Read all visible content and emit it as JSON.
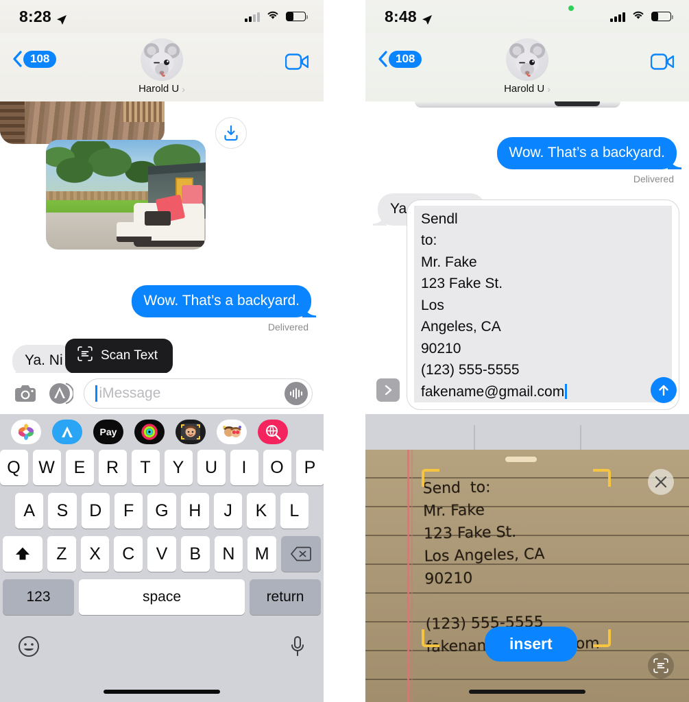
{
  "left_phone": {
    "status_bar": {
      "time": "8:28",
      "location_icon": "location-arrow-icon",
      "cellular": "signal-bars-icon",
      "wifi": "wifi-icon",
      "battery": "battery-icon"
    },
    "nav": {
      "back_badge": "108",
      "contact_name": "Harold U",
      "disclosure": "›",
      "video_label": "facetime-video-icon"
    },
    "messages": [
      {
        "type": "photo",
        "name": "deck-photo"
      },
      {
        "type": "photo",
        "name": "backyard-photo"
      },
      {
        "type": "outgoing",
        "text": "Wow. That’s a backyard.",
        "status": "Delivered"
      },
      {
        "type": "incoming",
        "text": "Ya.  Ni"
      }
    ],
    "download_button": "download-icon",
    "tooltip": {
      "label": "Scan Text",
      "icon": "scan-text-icon"
    },
    "input_bar": {
      "camera_icon": "camera-icon",
      "apps_icon": "app-store-icon",
      "placeholder": "iMessage",
      "audio_icon": "audio-waveform-icon"
    },
    "keyboard": {
      "app_strip": [
        {
          "name": "photos-app-icon",
          "glyph": "❀"
        },
        {
          "name": "app-store-icon",
          "glyph": "A"
        },
        {
          "name": "apple-pay-icon",
          "glyph": "Pay"
        },
        {
          "name": "fitness-rings-icon",
          "glyph": "◉"
        },
        {
          "name": "memoji-capture-icon",
          "glyph": "🙂"
        },
        {
          "name": "memoji-stickers-icon",
          "glyph": "😍"
        },
        {
          "name": "gif-search-icon",
          "glyph": "🔍"
        }
      ],
      "row1": [
        "Q",
        "W",
        "E",
        "R",
        "T",
        "Y",
        "U",
        "I",
        "O",
        "P"
      ],
      "row2": [
        "A",
        "S",
        "D",
        "F",
        "G",
        "H",
        "J",
        "K",
        "L"
      ],
      "row3": [
        "Z",
        "X",
        "C",
        "V",
        "B",
        "N",
        "M"
      ],
      "shift_icon": "shift-key-icon",
      "backspace_icon": "backspace-key-icon",
      "numbers_label": "123",
      "space_label": "space",
      "return_label": "return",
      "emoji_icon": "emoji-key-icon",
      "dictation_icon": "microphone-icon"
    }
  },
  "right_phone": {
    "status_bar": {
      "time": "8:48",
      "location_icon": "location-arrow-icon",
      "camera_dot": "green-privacy-dot",
      "cellular": "signal-bars-icon",
      "wifi": "wifi-icon",
      "battery": "battery-icon"
    },
    "nav": {
      "back_badge": "108",
      "contact_name": "Harold U",
      "disclosure": "›",
      "video_label": "facetime-video-icon"
    },
    "messages": [
      {
        "type": "outgoing",
        "text": "Wow. That’s a backyard.",
        "status": "Delivered"
      },
      {
        "type": "incoming",
        "text": "Ya.  Nice size"
      }
    ],
    "compose": {
      "expand_icon": "expand-toolbar-chevron-icon",
      "value": "Sendl\nto:\nMr. Fake\n123 Fake St.\nLos\nAngeles, CA\n90210\n(123) 555-5555\nfakename@gmail.com",
      "send_icon": "send-arrow-up-icon"
    },
    "scan_view": {
      "close_icon": "close-x-icon",
      "live_text_icon": "scan-text-icon",
      "insert_label": "insert",
      "note_text": "Send  to:\nMr. Fake\n123 Fake St.\nLos Angeles, CA\n90210\n\n(123) 555-5555\nfakename@ gmail.com",
      "frame_corners": "yellow-detection-corners"
    }
  },
  "colors": {
    "imessage_blue": "#0a84ff",
    "incoming_gray": "#e9e9eb",
    "keyboard_bg": "#d1d3d9",
    "key_white": "#ffffff",
    "key_gray": "#adb1bc",
    "tooltip_black": "#1c1c1e",
    "detection_yellow": "#f5c542",
    "delivered_gray": "#8a8a8e"
  }
}
